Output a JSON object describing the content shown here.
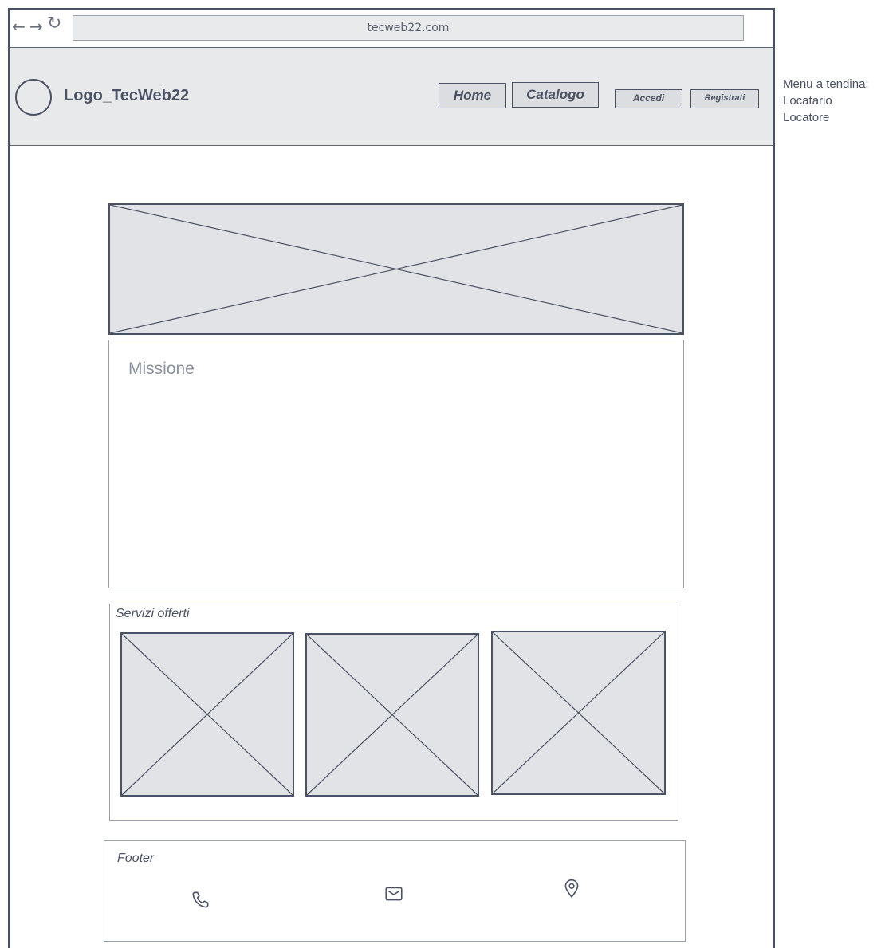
{
  "browser": {
    "url": "tecweb22.com",
    "back_icon": "arrow-left-icon",
    "forward_icon": "arrow-right-icon",
    "reload_icon": "reload-icon"
  },
  "header": {
    "logo_text": "Logo_TecWeb22",
    "nav": {
      "home": "Home",
      "catalog": "Catalogo"
    },
    "auth": {
      "login": "Accedi",
      "register": "Registrati"
    }
  },
  "main": {
    "mission_title": "Missione",
    "services_title": "Servizi offerti"
  },
  "footer": {
    "title": "Footer",
    "icons": [
      "phone-icon",
      "mail-icon",
      "location-icon"
    ]
  },
  "annotation": {
    "line1": "Menu a tendina:",
    "line2": "Locatario",
    "line3": "Locatore"
  },
  "colors": {
    "stroke": "#4b5263",
    "placeholder_fill": "#e2e3e6",
    "header_bg": "#e8e9eb"
  }
}
